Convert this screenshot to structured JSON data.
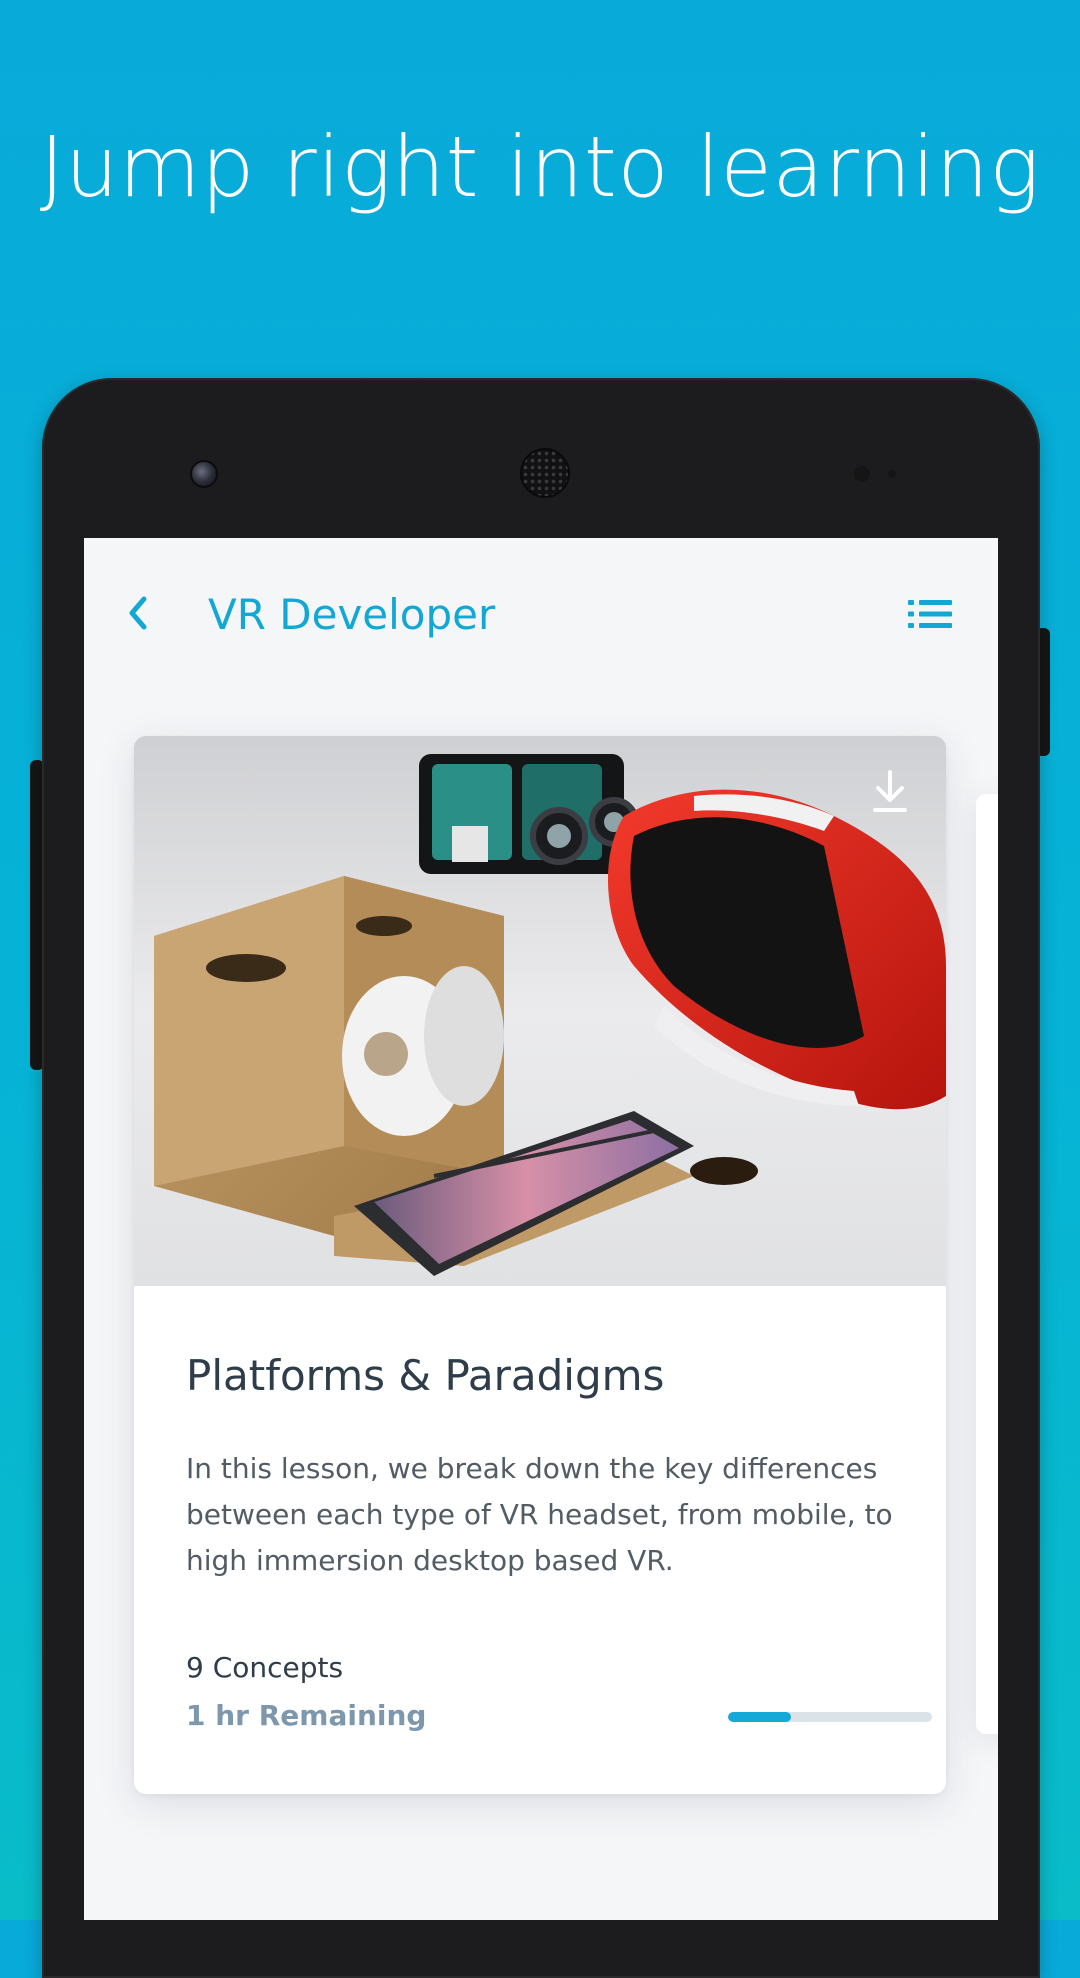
{
  "promo": {
    "headline": "Jump right into learning"
  },
  "colors": {
    "accent": "#13a7d4",
    "background_top": "#08aad9",
    "background_bottom": "#09bcc8",
    "title_text": "#2e3d49",
    "muted_text": "#7d97ad"
  },
  "appbar": {
    "back_icon": "chevron-left-icon",
    "title": "VR Developer",
    "menu_icon": "list-icon"
  },
  "lesson_card": {
    "image_alt": "VR headsets: cardboard viewer, red View-Master viewer, black mobile viewer and a smartphone",
    "download_icon": "download-icon",
    "title": "Platforms & Paradigms",
    "description": "In this lesson, we break down the key differences between each type of VR headset, from mobile, to high immersion desktop based VR.",
    "concepts": "9 Concepts",
    "remaining": "1 hr Remaining",
    "progress_percent": 31
  }
}
